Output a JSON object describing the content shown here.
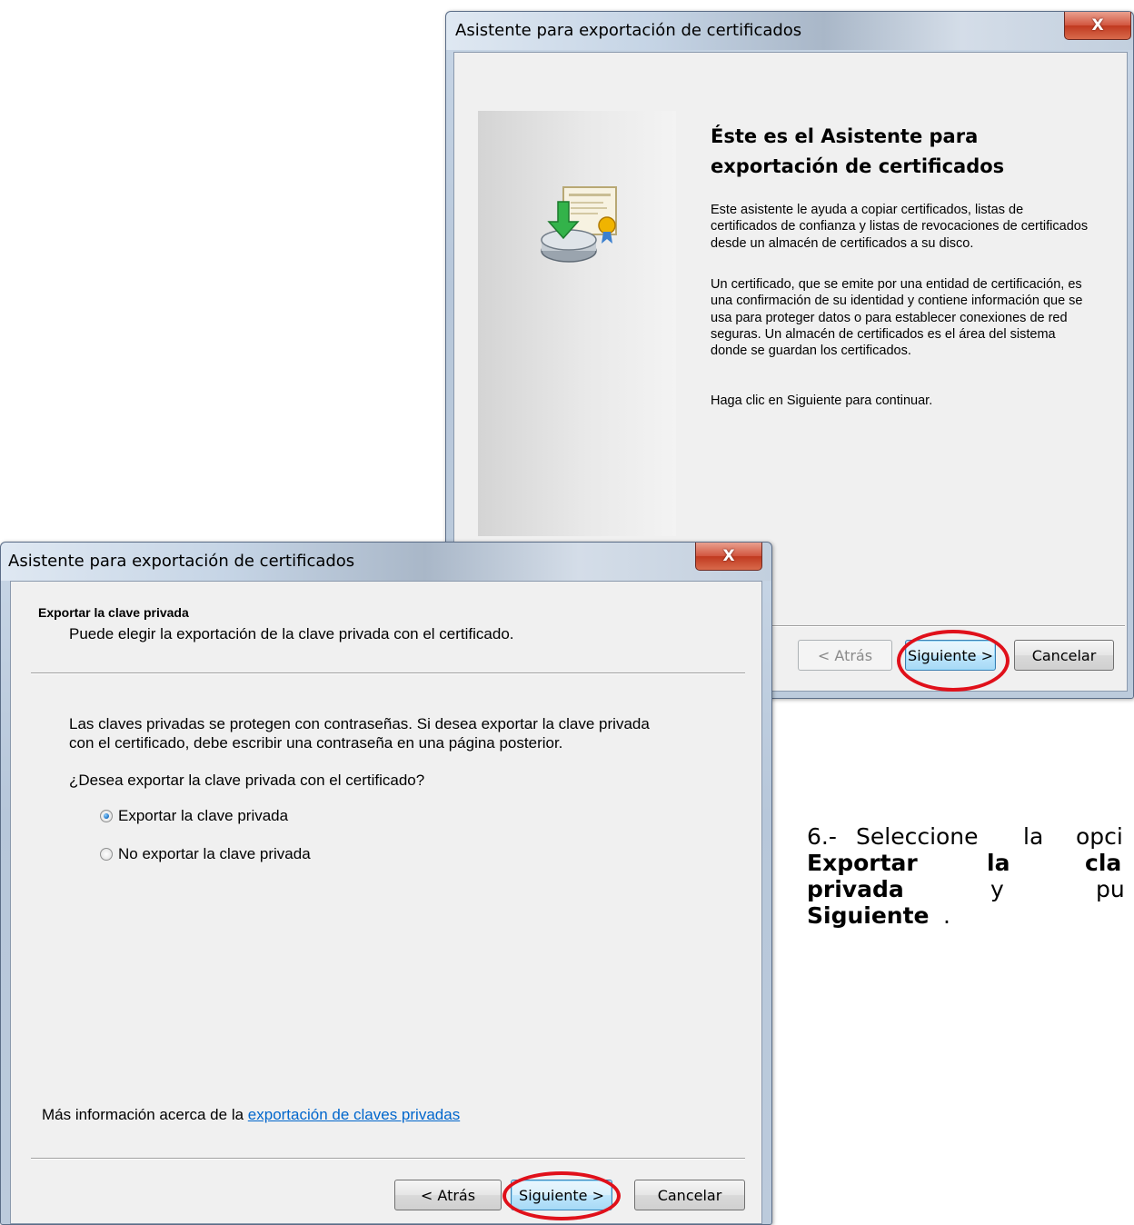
{
  "back_window": {
    "title": "Asistente para exportación de certificados",
    "close": "X",
    "heading": "Éste es el Asistente para exportación de certificados",
    "paragraph1": "Este asistente le ayuda a copiar certificados, listas de certificados de confianza y listas de revocaciones de certificados desde un almacén de certificados a su disco.",
    "paragraph2": "Un certificado, que se emite por una entidad de certificación, es una confirmación de su identidad y contiene información que se usa para proteger datos o para establecer conexiones de red seguras. Un almacén de certificados es el área del sistema donde se guardan los certificados.",
    "paragraph3": "Haga clic en Siguiente para continuar.",
    "buttons": {
      "back": "< Atrás",
      "next": "Siguiente >",
      "cancel": "Cancelar"
    },
    "icon": "certificate-export-icon"
  },
  "front_window": {
    "title": "Asistente para exportación de certificados",
    "close": "X",
    "header_title": "Exportar la clave privada",
    "header_subtitle": "Puede elegir la exportación de la clave privada con el certificado.",
    "body_line1": "Las claves privadas se protegen con contraseñas. Si desea exportar la clave privada",
    "body_line2": "con el certificado, debe escribir una contraseña en una página posterior.",
    "question": "¿Desea exportar la clave privada con el certificado?",
    "options": [
      {
        "label": "Exportar la clave privada",
        "selected": true
      },
      {
        "label": "No exportar la clave privada",
        "selected": false
      }
    ],
    "more_info_prefix": "Más información acerca de la ",
    "more_info_link": "exportación de claves privadas",
    "buttons": {
      "back": "< Atrás",
      "next": "Siguiente >",
      "cancel": "Cancelar"
    }
  },
  "instruction": {
    "w1": "6.-",
    "w2": "Seleccione",
    "w3": "la",
    "w4": "opci",
    "w5": "Exportar",
    "w6": "la",
    "w7": "cla",
    "w8": "privada",
    "w9": "y",
    "w10": "pu",
    "w11": "Siguiente",
    "w12": "."
  },
  "colors": {
    "highlight_oval": "#e0101a",
    "link": "#0066cc"
  }
}
